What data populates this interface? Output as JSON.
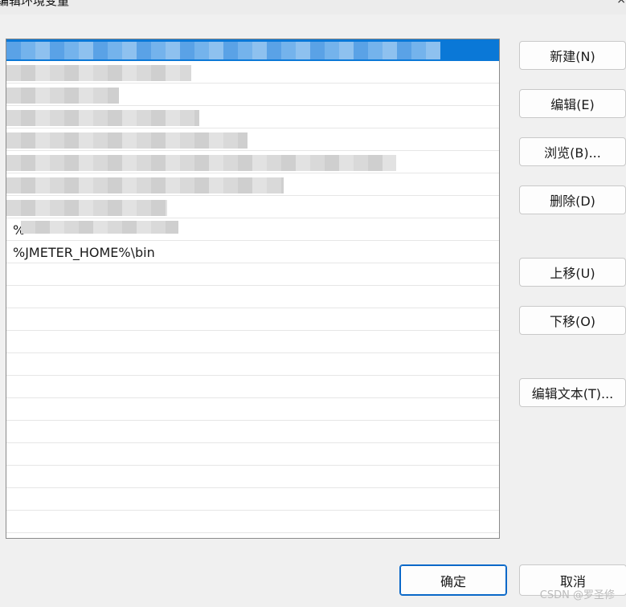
{
  "window": {
    "title": "编辑环境变量",
    "close_glyph": "×"
  },
  "list": {
    "selected_index": 0,
    "visible_item": "%JMETER_HOME%\\bin",
    "partial_item": "%"
  },
  "buttons": {
    "new": "新建(N)",
    "edit": "编辑(E)",
    "browse": "浏览(B)...",
    "delete": "删除(D)",
    "move_up": "上移(U)",
    "move_down": "下移(O)",
    "edit_text": "编辑文本(T)..."
  },
  "footer": {
    "ok": "确定",
    "cancel": "取消"
  },
  "watermark": "CSDN @罗圣修"
}
